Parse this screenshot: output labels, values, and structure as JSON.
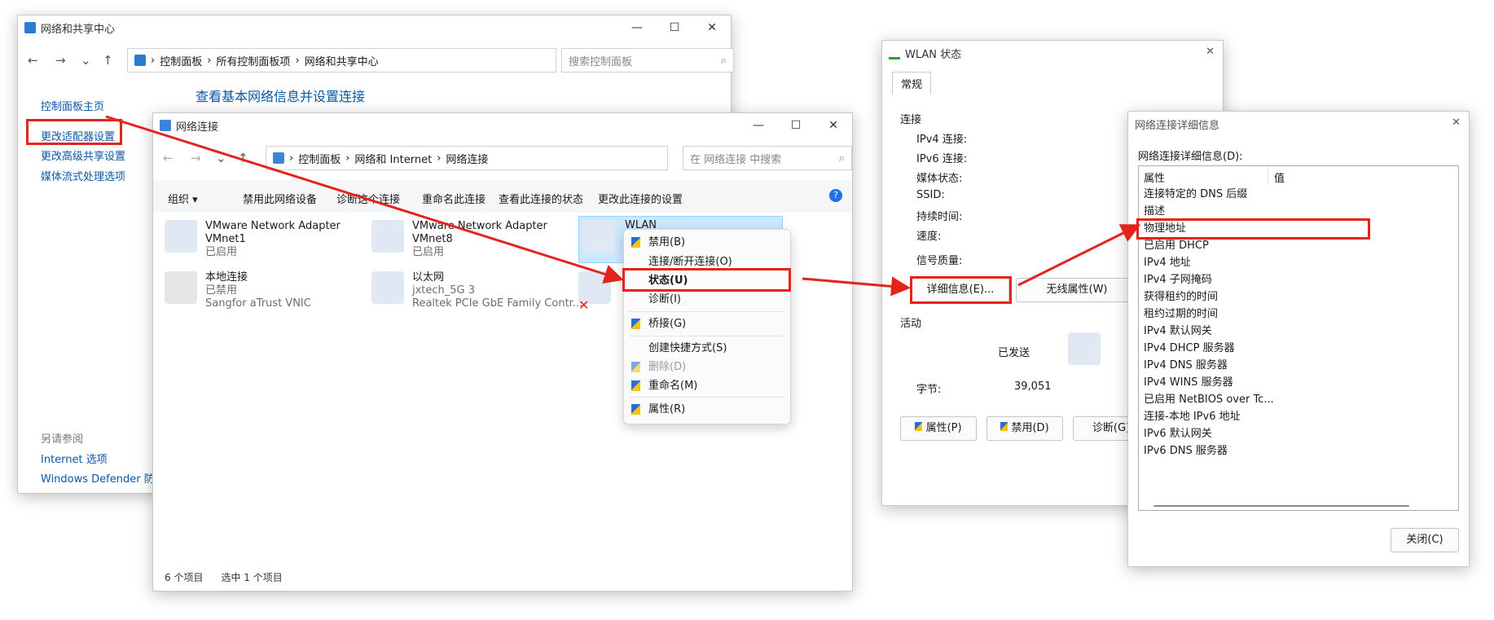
{
  "ncw": {
    "title": "网络和共享中心",
    "breadcrumb": [
      "控制面板",
      "所有控制面板项",
      "网络和共享中心"
    ],
    "search_placeholder": "搜索控制面板",
    "sidebar": [
      "控制面板主页",
      "更改适配器设置",
      "更改高级共享设置",
      "媒体流式处理选项"
    ],
    "heading": "查看基本网络信息并设置连接",
    "see_also": "另请参阅",
    "see_also_links": [
      "Internet 选项",
      "Windows Defender 防火墙"
    ]
  },
  "nc": {
    "title": "网络连接",
    "breadcrumb": [
      "控制面板",
      "网络和 Internet",
      "网络连接"
    ],
    "search_placeholder": "在 网络连接 中搜索",
    "toolbar": [
      "组织 ▾",
      "禁用此网络设备",
      "诊断这个连接",
      "重命名此连接",
      "查看此连接的状态",
      "更改此连接的设置"
    ],
    "adapters": [
      {
        "name": "VMware Network Adapter VMnet1",
        "status": "已启用",
        "device": ""
      },
      {
        "name": "VMware Network Adapter VMnet8",
        "status": "已启用",
        "device": ""
      },
      {
        "name": "WLAN",
        "status": "",
        "device": ""
      },
      {
        "name": "本地连接",
        "status": "已禁用",
        "device": "Sangfor aTrust VNIC"
      },
      {
        "name": "以太网",
        "status": "jxtech_5G 3",
        "device": "Realtek PCIe GbE Family Contr..."
      }
    ],
    "status_bar": [
      "6 个项目",
      "选中 1 个项目"
    ]
  },
  "menu": {
    "items": [
      "禁用(B)",
      "连接/断开连接(O)",
      "状态(U)",
      "诊断(I)",
      "桥接(G)",
      "创建快捷方式(S)",
      "删除(D)",
      "重命名(M)",
      "属性(R)"
    ]
  },
  "wlan": {
    "title": "WLAN 状态",
    "tab": "常规",
    "group_conn": "连接",
    "labels": [
      "IPv4 连接:",
      "IPv6 连接:",
      "媒体状态:",
      "SSID:",
      "持续时间:",
      "速度:"
    ],
    "signal": "信号质量:",
    "details_btn": "详细信息(E)...",
    "wireless_btn": "无线属性(W)",
    "group_activity": "活动",
    "sent": "已发送",
    "bytes_label": "字节:",
    "bytes_value": "39,051",
    "btn_props": "属性(P)",
    "btn_disable": "禁用(D)",
    "btn_diag": "诊断(G)"
  },
  "details": {
    "title": "网络连接详细信息",
    "caption": "网络连接详细信息(D):",
    "col_prop": "属性",
    "col_val": "值",
    "rows": [
      "连接特定的 DNS 后缀",
      "描述",
      "物理地址",
      "已启用 DHCP",
      "IPv4 地址",
      "IPv4 子网掩码",
      "获得租约的时间",
      "租约过期的时间",
      "IPv4 默认网关",
      "IPv4 DHCP 服务器",
      "IPv4 DNS 服务器",
      "IPv4 WINS 服务器",
      "已启用 NetBIOS over Tc...",
      "连接-本地 IPv6 地址",
      "IPv6 默认网关",
      "IPv6 DNS 服务器"
    ],
    "close_btn": "关闭(C)"
  }
}
